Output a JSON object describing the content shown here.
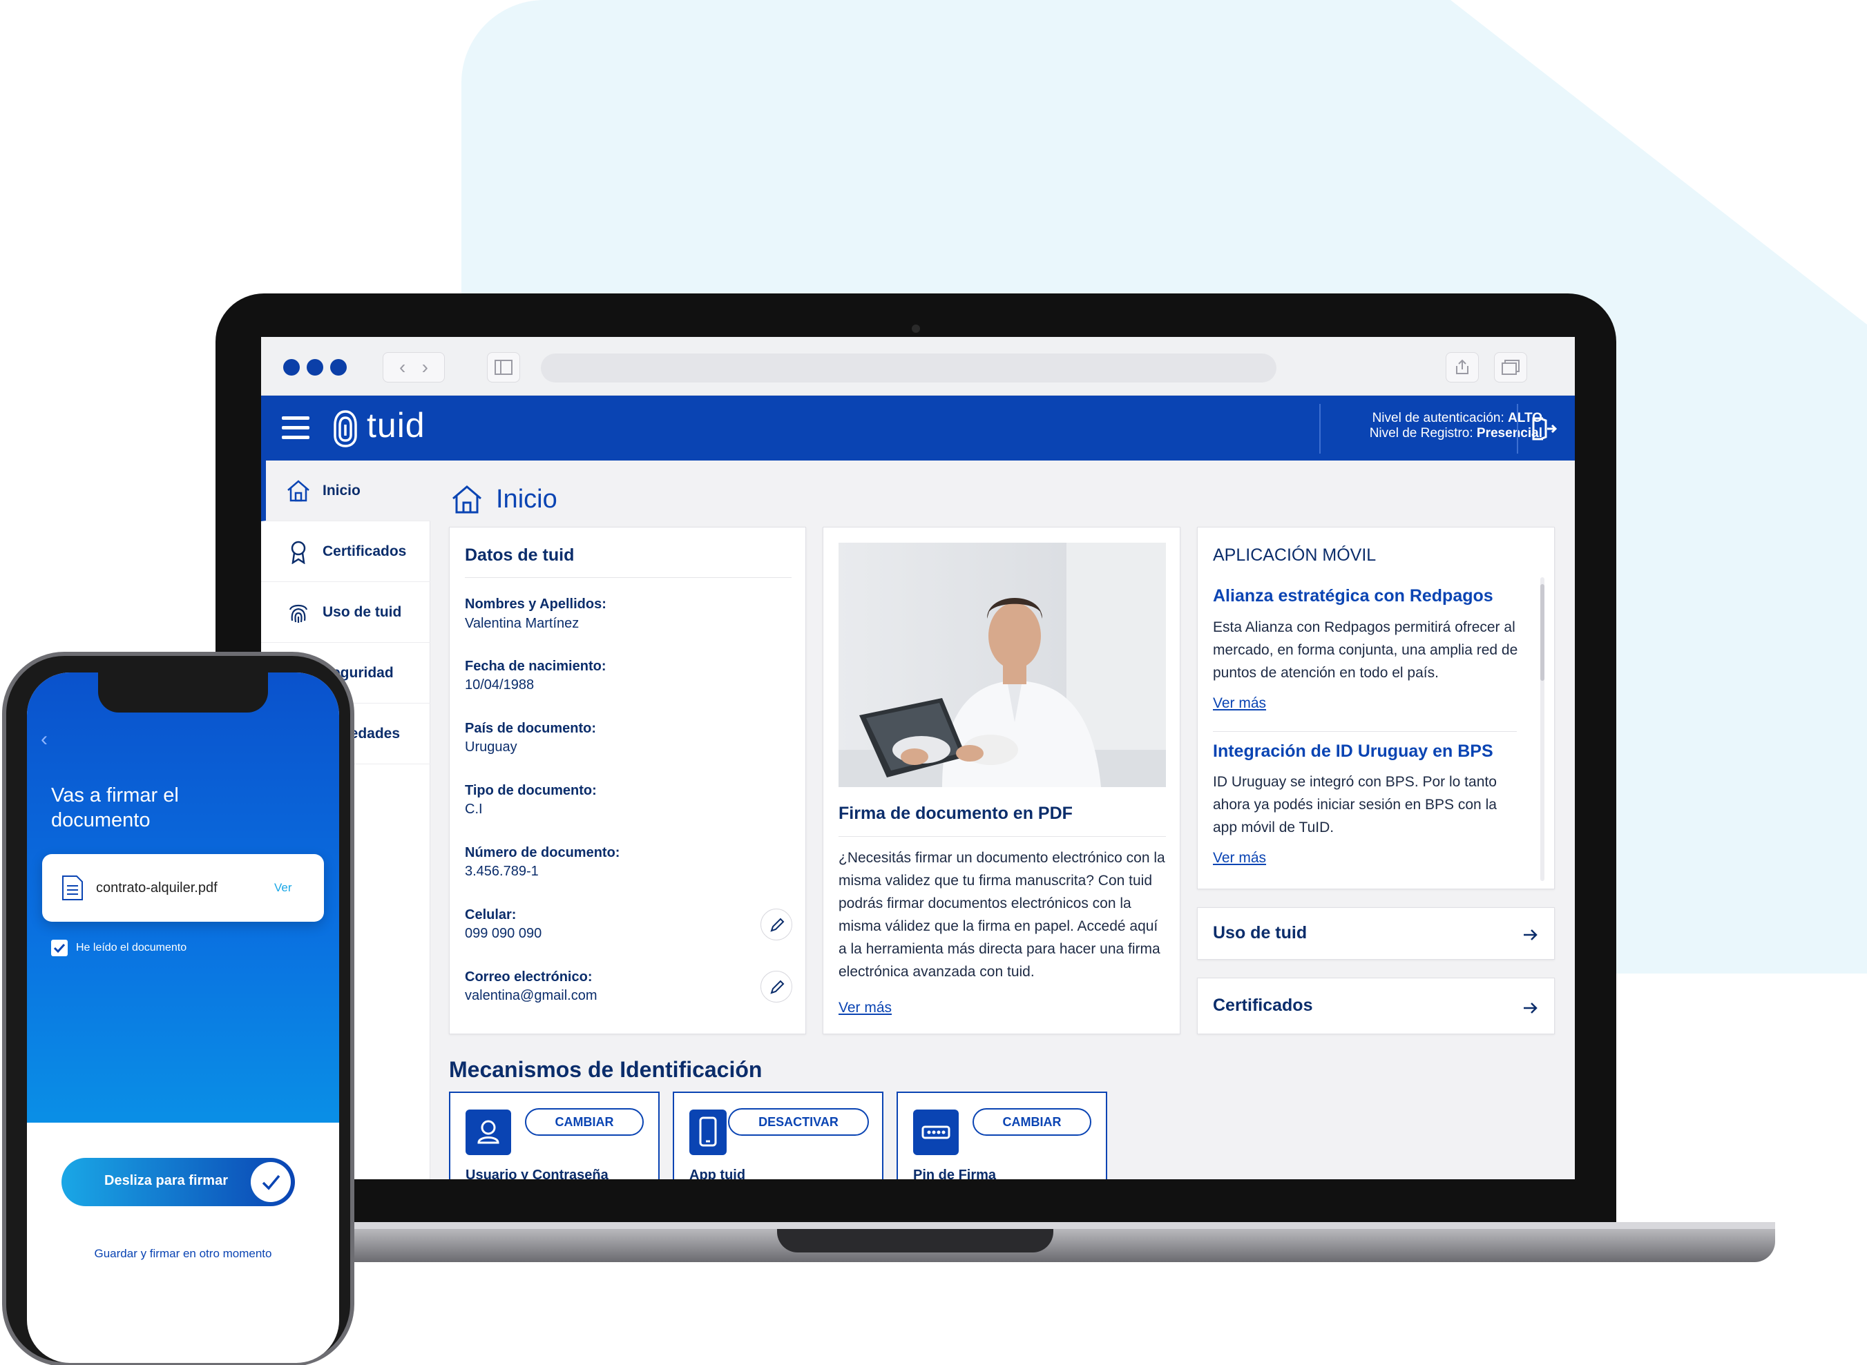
{
  "browser": {},
  "header": {
    "logo_text": "tuid",
    "auth_level_label": "Nivel de autenticación: ",
    "auth_level_value": "ALTO",
    "registry_level_label": "Nivel de Registro: ",
    "registry_level_value": "Presencial"
  },
  "sidebar": {
    "items": [
      {
        "label": "Inicio",
        "icon": "home-icon"
      },
      {
        "label": "Certificados",
        "icon": "ribbon-icon"
      },
      {
        "label": "Uso de tuid",
        "icon": "fingerprint-icon"
      },
      {
        "label": "Seguridad",
        "icon": "lock-icon"
      },
      {
        "label": "Novedades",
        "icon": "bell-icon"
      }
    ]
  },
  "page": {
    "title": "Inicio"
  },
  "datos": {
    "title": "Datos de tuid",
    "fields": [
      {
        "label": "Nombres y Apellidos:",
        "value": "Valentina Martínez"
      },
      {
        "label": "Fecha de nacimiento:",
        "value": "10/04/1988"
      },
      {
        "label": "País de documento:",
        "value": "Uruguay"
      },
      {
        "label": "Tipo de documento:",
        "value": "C.I"
      },
      {
        "label": "Número de documento:",
        "value": "3.456.789-1"
      },
      {
        "label": "Celular:",
        "value": "099 090 090"
      },
      {
        "label": "Correo electrónico:",
        "value": "valentina@gmail.com"
      }
    ]
  },
  "firma": {
    "title": "Firma de documento en PDF",
    "body": "¿Necesitás firmar un documento electrónico con la misma validez que tu firma manuscrita? Con tuid podrás firmar documentos electrónicos con la misma válidez que la firma en papel. Accedé aquí a la herramienta más directa para hacer una firma electrónica avanzada con tuid.",
    "link": "Ver más"
  },
  "app_movil": {
    "title": "APLICACIÓN MÓVIL",
    "news": [
      {
        "title": "Alianza estratégica con Redpagos",
        "body": "Esta Alianza con Redpagos permitirá ofrecer al mercado, en forma conjunta, una amplia red de puntos de atención en todo el país.",
        "link": "Ver más"
      },
      {
        "title": "Integración de ID Uruguay en BPS",
        "body": "ID Uruguay se integró con BPS. Por lo tanto ahora ya podés iniciar sesión en BPS con la app móvil de TuID.",
        "link": "Ver más"
      }
    ]
  },
  "quick_links": [
    {
      "label": "Uso de tuid"
    },
    {
      "label": "Certificados"
    }
  ],
  "mecanismos": {
    "title": "Mecanismos de Identificación",
    "cards": [
      {
        "label": "Usuario y Contraseña",
        "button": "CAMBIAR",
        "icon": "user-icon"
      },
      {
        "label": "App tuid",
        "button": "DESACTIVAR",
        "icon": "phone-icon"
      },
      {
        "label": "Pin de Firma",
        "button": "CAMBIAR",
        "icon": "pin-icon"
      }
    ]
  },
  "phone": {
    "title": "Vas a firmar el documento",
    "file_name": "contrato-alquiler.pdf",
    "file_action": "Ver",
    "checkbox_label": "He leído el documento",
    "swipe_label": "Desliza para firmar",
    "save_later": "Guardar y firmar en otro momento"
  }
}
